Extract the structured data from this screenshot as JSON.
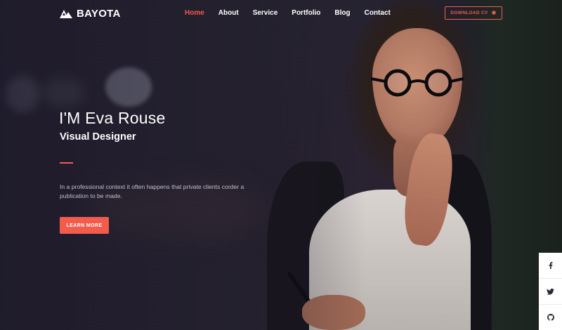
{
  "brand": {
    "name": "BAYOTA"
  },
  "nav": {
    "items": [
      {
        "label": "Home",
        "active": true
      },
      {
        "label": "About",
        "active": false
      },
      {
        "label": "Service",
        "active": false
      },
      {
        "label": "Portfolio",
        "active": false
      },
      {
        "label": "Blog",
        "active": false
      },
      {
        "label": "Contact",
        "active": false
      }
    ]
  },
  "header": {
    "download_label": "DOWNLOAD CV",
    "download_icon": "asterisk-icon"
  },
  "hero": {
    "title": "I'M Eva Rouse",
    "subtitle": "Visual Designer",
    "description": "In a professional context it often happens that private clients corder a publication to be made.",
    "cta_label": "LEARN MORE"
  },
  "social": {
    "icons": [
      "facebook-icon",
      "twitter-icon",
      "github-icon"
    ]
  },
  "colors": {
    "accent": "#f25c4c",
    "text": "#ffffff",
    "muted": "#c3bfcf",
    "background": "#1f1c2a"
  }
}
